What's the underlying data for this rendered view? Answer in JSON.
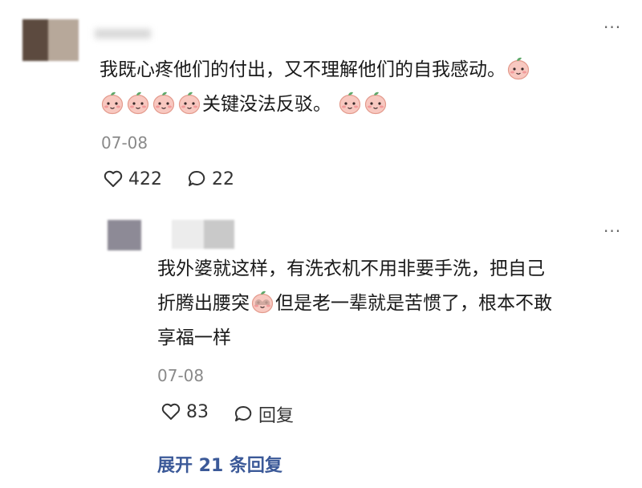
{
  "comment": {
    "text_part1": "我既心疼他们的付出，又不理解他们的自我感动。",
    "text_part2": "关键没法反驳。",
    "date": "07-08",
    "likes": "422",
    "replies_count": "22",
    "colors": {
      "avatar_left": "#5c4a3f",
      "avatar_right": "#b7a89a"
    }
  },
  "reply": {
    "text_line1": "我外婆就这样，有洗衣机不用非要手洗，把自己",
    "text_line2_a": "折腾出腰突",
    "text_line2_b": "但是老一辈就是苦惯了，根本不敢",
    "text_line3": "享福一样",
    "date": "07-08",
    "likes": "83",
    "reply_label": "回复",
    "colors": {
      "avatar": "#8d8a96"
    }
  },
  "more_replies": {
    "label": "展开 21 条回复"
  },
  "icons": [
    "heart-icon",
    "comment-bubble-icon",
    "more-dots-icon",
    "peach-face-emoji"
  ],
  "accent_color": "#3b5998"
}
